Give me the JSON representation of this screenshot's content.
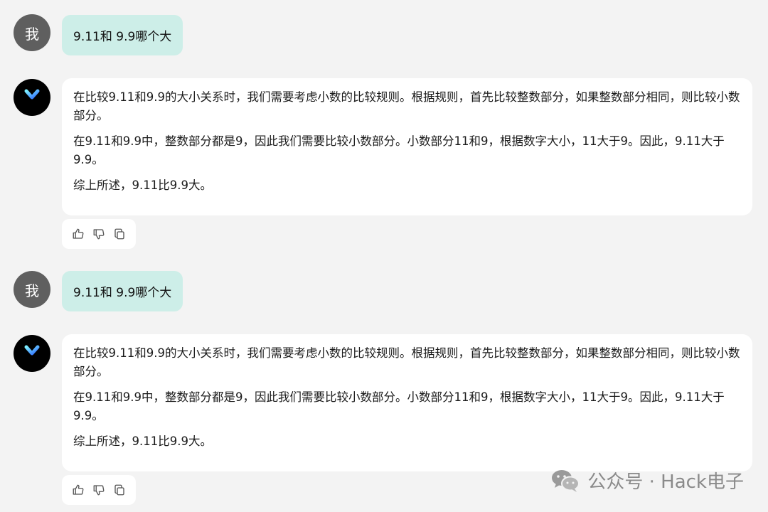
{
  "conversation": [
    {
      "user": {
        "avatar_label": "我",
        "message": "9.11和 9.9哪个大"
      },
      "assistant": {
        "avatar_icon": "y-logo-icon",
        "paragraphs": [
          "在比较9.11和9.9的大小关系时，我们需要考虑小数的比较规则。根据规则，首先比较整数部分，如果整数部分相同，则比较小数部分。",
          "在9.11和9.9中，整数部分都是9，因此我们需要比较小数部分。小数部分11和9，根据数字大小，11大于9。因此，9.11大于9.9。",
          "综上所述，9.11比9.9大。"
        ],
        "actions": [
          "thumbs-up-icon",
          "thumbs-down-icon",
          "copy-icon"
        ]
      }
    },
    {
      "user": {
        "avatar_label": "我",
        "message": "9.11和 9.9哪个大"
      },
      "assistant": {
        "avatar_icon": "y-logo-icon",
        "paragraphs": [
          "在比较9.11和9.9的大小关系时，我们需要考虑小数的比较规则。根据规则，首先比较整数部分，如果整数部分相同，则比较小数部分。",
          "在9.11和9.9中，整数部分都是9，因此我们需要比较小数部分。小数部分11和9，根据数字大小，11大于9。因此，9.11大于9.9。",
          "综上所述，9.11比9.9大。"
        ],
        "actions": [
          "thumbs-up-icon",
          "thumbs-down-icon",
          "copy-icon"
        ]
      }
    }
  ],
  "watermark": {
    "icon": "wechat-icon",
    "text": "公众号 · Hack电子"
  },
  "colors": {
    "background": "#f3f3f3",
    "user_bubble": "#cdeee8",
    "assistant_bubble": "#ffffff",
    "user_avatar": "#5f5f5f",
    "assistant_avatar": "#000000",
    "logo_gradient_start": "#7ef0ff",
    "logo_gradient_end": "#2f6bff"
  }
}
